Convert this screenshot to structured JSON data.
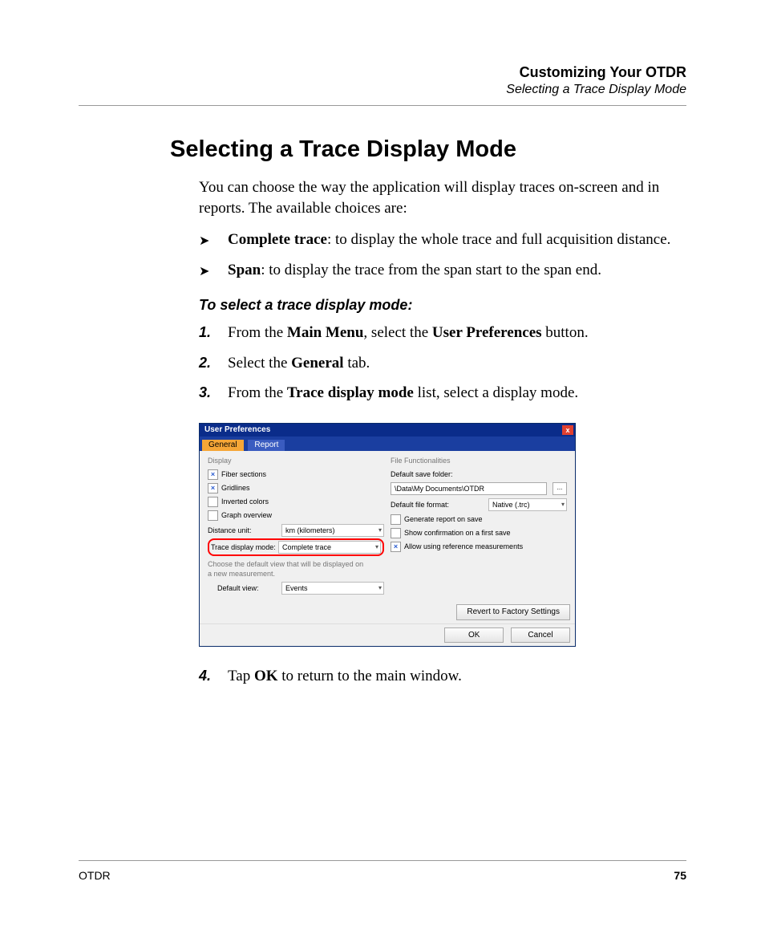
{
  "header": {
    "chapter": "Customizing Your OTDR",
    "section": "Selecting a Trace Display Mode"
  },
  "title": "Selecting a Trace Display Mode",
  "intro": "You can choose the way the application will display traces on-screen and in reports. The available choices are:",
  "bullets": [
    {
      "term": "Complete trace",
      "desc": ": to display the whole trace and full acquisition distance."
    },
    {
      "term": "Span",
      "desc": ": to display the trace from the span start to the span end."
    }
  ],
  "instr_head": "To select a trace display mode:",
  "steps": [
    {
      "n": "1.",
      "pre": "From the ",
      "b1": "Main Menu",
      "mid": ", select the ",
      "b2": "User Preferences",
      "post": " button."
    },
    {
      "n": "2.",
      "pre": "Select the ",
      "b1": "General",
      "mid": " tab.",
      "b2": "",
      "post": ""
    },
    {
      "n": "3.",
      "pre": "From the ",
      "b1": "Trace display mode",
      "mid": " list, select a display mode.",
      "b2": "",
      "post": ""
    }
  ],
  "step4": {
    "n": "4.",
    "pre": "Tap ",
    "b1": "OK",
    "post": " to return to the main window."
  },
  "dialog": {
    "title": "User Preferences",
    "close": "x",
    "tabs": {
      "general": "General",
      "report": "Report"
    },
    "left": {
      "group": "Display",
      "fiber_sections": "Fiber sections",
      "gridlines": "Gridlines",
      "inverted_colors": "Inverted colors",
      "graph_overview": "Graph overview",
      "distance_unit_lbl": "Distance unit:",
      "distance_unit_val": "km (kilometers)",
      "trace_mode_lbl": "Trace display mode:",
      "trace_mode_val": "Complete trace",
      "note": "Choose the default view that will be displayed on a new measurement.",
      "default_view_lbl": "Default view:",
      "default_view_val": "Events"
    },
    "right": {
      "group": "File Functionalities",
      "default_save_lbl": "Default save folder:",
      "default_save_val": "\\Data\\My Documents\\OTDR",
      "browse": "...",
      "default_format_lbl": "Default file format:",
      "default_format_val": "Native (.trc)",
      "gen_report": "Generate report on save",
      "show_confirm": "Show confirmation on a first save",
      "allow_ref": "Allow using reference measurements"
    },
    "buttons": {
      "revert": "Revert to Factory Settings",
      "ok": "OK",
      "cancel": "Cancel"
    }
  },
  "footer": {
    "left": "OTDR",
    "page": "75"
  }
}
